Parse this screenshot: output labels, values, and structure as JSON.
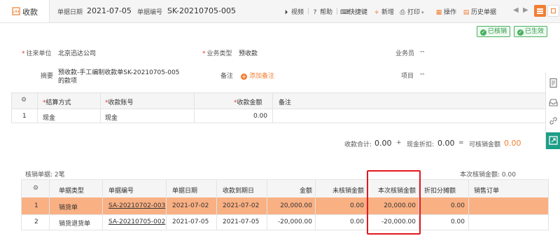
{
  "tab": {
    "label": "收款"
  },
  "header": {
    "date_label": "单据日期",
    "date_value": "2021-07-05",
    "number_label": "单据编号",
    "number_value": "SK-20210705-005"
  },
  "toolbar": {
    "video": "视频",
    "help": "帮助",
    "shortcut": "快捷键",
    "new": "新增",
    "print": "打印",
    "operate": "操作",
    "history": "历史单据"
  },
  "badges": {
    "written_off": "已核销",
    "effective": "已生效"
  },
  "form": {
    "partner_label": "往来单位",
    "partner_value": "北京迅达公司",
    "biz_type_label": "业务类型",
    "biz_type_value": "预收款",
    "salesman_label": "业务员",
    "salesman_value": "--",
    "summary_label": "摘要",
    "summary_line1": "预收款-手工编制收款单SK-20210705-005",
    "summary_line2": "的款项",
    "note_label": "备注",
    "add_note": "添加备注",
    "project_label": "项目",
    "project_value": "--"
  },
  "settle_table": {
    "headers": [
      "结算方式",
      "收款账号",
      "收款金额",
      "备注"
    ],
    "row": {
      "index": "1",
      "method": "现金",
      "account": "现金",
      "amount": "0.00",
      "note": ""
    }
  },
  "totals": {
    "receipt_label": "收款合计:",
    "receipt_value": "0.00",
    "plus": "+",
    "discount_label": "现金折扣:",
    "discount_value": "0.00",
    "equals": "=",
    "writeoff_label": "可核销金额",
    "writeoff_value": "0.00"
  },
  "writeoff": {
    "count_text": "核销单据: 2笔",
    "current_text": "本次核销金额: 0.00",
    "headers": [
      "单据类型",
      "单据编号",
      "单据日期",
      "收款到期日",
      "金额",
      "未核销金额",
      "本次核销金额",
      "折扣分摊额",
      "销售订单"
    ],
    "rows": [
      {
        "index": "1",
        "type": "销货单",
        "number": "SA-20210702-003",
        "date": "2021-07-02",
        "due": "2021-07-02",
        "amount": "20,000.00",
        "unwritten": "0.00",
        "current": "20,000.00",
        "discount": "0.00",
        "order": ""
      },
      {
        "index": "2",
        "type": "销货退货单",
        "number": "SA-20210705-002",
        "date": "2021-07-05",
        "due": "2021-07-05",
        "amount": "-20,000.00",
        "unwritten": "0.00",
        "current": "-20,000.00",
        "discount": "0.00",
        "order": ""
      }
    ]
  },
  "colors": {
    "accent": "#f17e33",
    "highlight_row": "#f9b083",
    "status_green": "#49b15f",
    "side_active": "#1d9e87",
    "annotation_red": "#e0191f"
  },
  "icons": [
    "receipt-icon",
    "video-icon",
    "help-icon",
    "keyboard-icon",
    "plus-icon",
    "printer-icon",
    "operate-icon",
    "history-icon",
    "settings-gear-icon",
    "document-icon",
    "tray-icon",
    "link-icon",
    "expand-icon"
  ]
}
